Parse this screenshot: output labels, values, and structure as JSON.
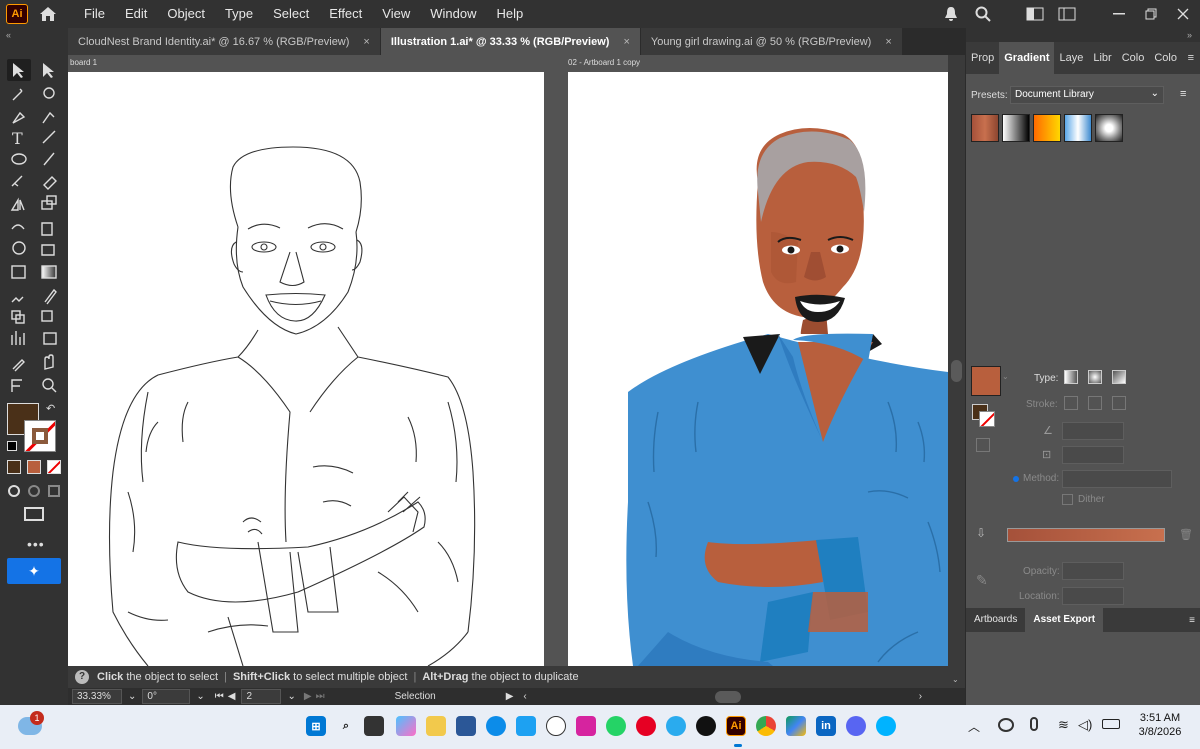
{
  "app": {
    "logo": "Ai",
    "accent": "#ff9a00"
  },
  "menu": [
    "File",
    "Edit",
    "Object",
    "Type",
    "Select",
    "Effect",
    "View",
    "Window",
    "Help"
  ],
  "tabs": [
    {
      "label": "CloudNest Brand Identity.ai* @ 16.67 % (RGB/Preview)",
      "active": false
    },
    {
      "label": "Illustration 1.ai* @ 33.33 % (RGB/Preview)",
      "active": true
    },
    {
      "label": "Young girl drawing.ai @ 50 % (RGB/Preview)",
      "active": false
    }
  ],
  "tab_close": "×",
  "artboards": [
    {
      "label": "board 1"
    },
    {
      "label": "02 - Artboard 1 copy"
    }
  ],
  "hint": {
    "part1_bold": "Click",
    "part1": " the object to select",
    "part2_bold": "Shift+Click",
    "part2": " to select multiple object",
    "part3_bold": "Alt+Drag",
    "part3": " the object to duplicate"
  },
  "status": {
    "zoom": "33.33%",
    "rotation": "0°",
    "artboard_num": "2",
    "tool": "Selection"
  },
  "panel": {
    "tabs": [
      "Prop",
      "Gradient",
      "Laye",
      "Libr",
      "Colo",
      "Colo"
    ],
    "presets_label": "Presets:",
    "presets_value": "Document Library",
    "type_label": "Type:",
    "stroke_label": "Stroke:",
    "method_label": "Method:",
    "dither_label": "Dither",
    "opacity_label": "Opacity:",
    "location_label": "Location:",
    "bottom_tabs": [
      "Artboards",
      "Asset Export"
    ]
  },
  "colors": {
    "fill": "#4a3018",
    "skin": "#b85f3d",
    "shirt": "#3f8fd0",
    "hair": "#a8a0a0",
    "gradient_start": "#a5513a",
    "gradient_end": "#c8704e"
  },
  "taskbar": {
    "time": "3:51 AM",
    "date": "3/8/2026",
    "weather_badge": "1"
  },
  "icons": [
    "home-icon",
    "bell-icon",
    "search-icon",
    "layout-icon",
    "minimize-icon",
    "restore-icon",
    "close-icon"
  ]
}
